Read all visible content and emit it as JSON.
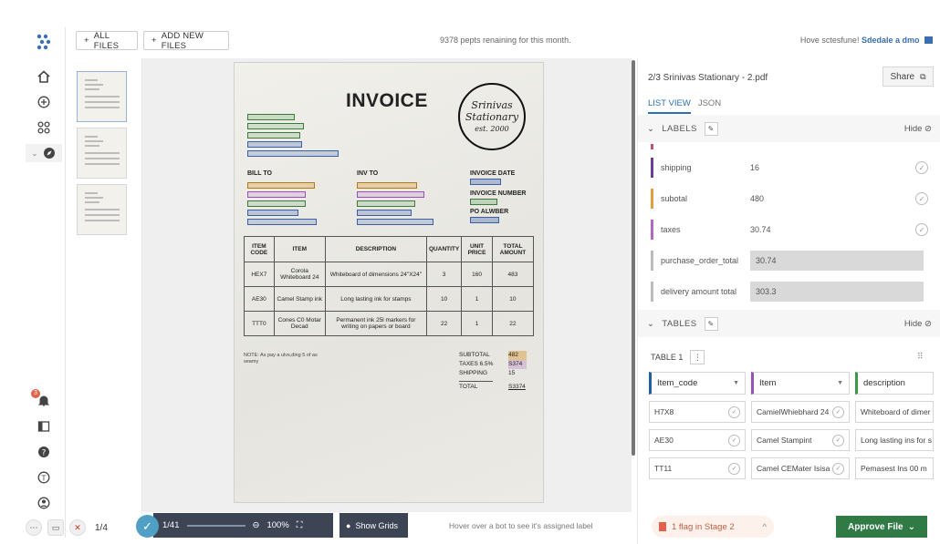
{
  "topbar": {
    "all_files": "ALL FILES",
    "add_new_files": "ADD NEW FILES",
    "pages_remaining": "9378 pepts renaining for this month.",
    "help_text": "Hove sctesfune! ",
    "schedule_demo": "Sdedale a dmo"
  },
  "rail": {
    "notification_count": "3",
    "icons": [
      "home-icon",
      "plus-circle-icon",
      "grid-icon",
      "compass-icon",
      "bell-icon",
      "sidebar-icon",
      "help-icon",
      "info-icon",
      "user-icon"
    ]
  },
  "document": {
    "title": "INVOICE",
    "stamp_line1": "Srinivas",
    "stamp_line2": "Stationary",
    "stamp_line3": "est. 2000",
    "bill_to": "BILL TO",
    "ship_to": "INV TO",
    "invoice_date": "INVOICE DATE",
    "invoice_number": "INVOICE NUMBER",
    "po_number": "PO ALWBER",
    "table_headers": [
      "ITEM CODE",
      "ITEM",
      "DESCRIPTION",
      "QUANTITY",
      "UNIT PRICE",
      "TOTAL AMOUNT"
    ],
    "table_rows": [
      [
        "HEX7",
        "Corola Whiteboard 24",
        "Whiteboard of dimensions 24\"X24\"",
        "3",
        "160",
        "483"
      ],
      [
        "AE30",
        "Camel Stamp ink",
        "Long lasting ink for stamps",
        "10",
        "1",
        "10"
      ],
      [
        "TTT0",
        "Cones C0 Motar Decad",
        "Permanent ink 25l markers for writing on papers or board",
        "22",
        "1",
        "22"
      ]
    ],
    "notes": "NOTE: As pay a ulvs,ding 5 of as seamy",
    "totals": [
      {
        "label": "SUBTOTAL",
        "value": "482"
      },
      {
        "label": "TAXES 6.5%",
        "value": "S374"
      },
      {
        "label": "SHIPPING",
        "value": "15"
      },
      {
        "label": "TOTAL",
        "value": "S3374"
      }
    ]
  },
  "viewer": {
    "page": "1/41",
    "zoom": "100%",
    "show_grids": "Show Grids",
    "hover_hint": "Hover over a bot to see it's assigned label",
    "page_count": "1/4"
  },
  "panel": {
    "title": "2/3  Srinivas Stationary - 2.pdf",
    "share": "Share",
    "tab_list": "LIST VIEW",
    "tab_json": "JSON",
    "labels_section": "LABELS",
    "tables_section": "TABLES",
    "hide": "Hide",
    "labels": [
      {
        "name": "shipping",
        "value": "16",
        "color": "#6a3d9a",
        "style": "plain"
      },
      {
        "name": "subotal",
        "value": "480",
        "color": "#e0a040",
        "style": "plain"
      },
      {
        "name": "taxes",
        "value": "30.74",
        "color": "#b06ac4",
        "style": "plain"
      },
      {
        "name": "purchase_order_total",
        "value": "30.74",
        "color": "#bbbbbb",
        "style": "box"
      },
      {
        "name": "delivery amount total",
        "value": "303.3",
        "color": "#bbbbbb",
        "style": "box"
      }
    ],
    "table_name": "TABLE 1",
    "columns": [
      {
        "label": "Item_code",
        "color": "#1f5fa8"
      },
      {
        "label": "Item",
        "color": "#9a4fb8"
      },
      {
        "label": "description",
        "color": "#3a9a4a"
      }
    ],
    "rows": [
      [
        "H7X8",
        "CamielWhiebhard 24",
        "Whiteboard of dimer"
      ],
      [
        "AE30",
        "Camel Stampint",
        "Long lasting ins for s"
      ],
      [
        "TT11",
        "Camel CEMater Isisa",
        "Pemasest Ins 00 m"
      ]
    ],
    "flag": "1 flag in Stage 2",
    "approve": "Approve File"
  }
}
